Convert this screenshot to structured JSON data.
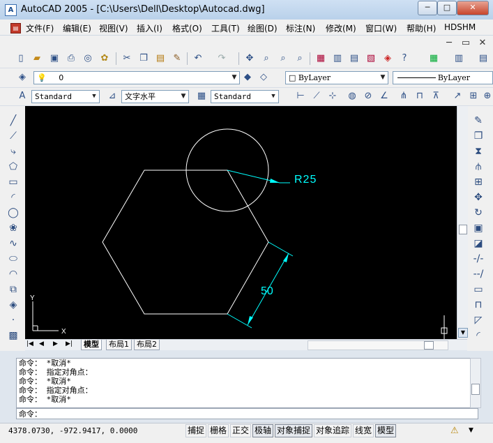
{
  "window": {
    "title": "AutoCAD 2005 - [C:\\Users\\Dell\\Desktop\\Autocad.dwg]",
    "app_icon_text": "A",
    "min_glyph": "─",
    "max_glyph": "□",
    "close_glyph": "✕"
  },
  "menu": {
    "items": [
      "文件(F)",
      "编辑(E)",
      "视图(V)",
      "插入(I)",
      "格式(O)",
      "工具(T)",
      "绘图(D)",
      "标注(N)",
      "修改(M)",
      "窗口(W)",
      "帮助(H)",
      "HDSHM"
    ],
    "doc_min": "─",
    "doc_restore": "▭",
    "doc_close": "✕"
  },
  "standard_toolbar": {
    "icons": [
      "new-icon",
      "open-icon",
      "save-icon",
      "print-icon",
      "preview-icon",
      "publish-icon",
      "cut-icon",
      "copy-icon",
      "paste-icon",
      "matchprop-icon",
      "undo-icon",
      "redo-icon",
      "pan-icon",
      "zoom-realtime-icon",
      "zoom-window-icon",
      "zoom-previous-icon",
      "properties-icon",
      "designcenter-icon",
      "toolpalettes-icon",
      "dbconnect-icon",
      "markup-icon",
      "help-icon"
    ]
  },
  "layers_toolbar": {
    "layer_value": "0",
    "color_value": "ByLayer",
    "linetype_value": "ByLayer"
  },
  "styles_toolbar": {
    "text_style": "Standard",
    "dim_style_text": "文字水平",
    "table_style": "Standard"
  },
  "drawing": {
    "radius_label": "R25",
    "dimension_label": "50",
    "ucs_y": "Y",
    "ucs_x": "X",
    "colors": {
      "background": "#000000",
      "geometry": "#ffffff",
      "dimension": "#00ffff"
    }
  },
  "layout_tabs": [
    "模型",
    "布局1",
    "布局2"
  ],
  "command": {
    "history": [
      "命令： *取消*",
      "命令： 指定对角点：",
      "命令： *取消*",
      "命令： 指定对角点：",
      "命令： *取消*"
    ],
    "prompt": "命令："
  },
  "status": {
    "coords": "4378.0730,  -972.9417,  0.0000",
    "toggles": [
      {
        "label": "捕捉",
        "on": false
      },
      {
        "label": "栅格",
        "on": false
      },
      {
        "label": "正交",
        "on": false
      },
      {
        "label": "极轴",
        "on": true
      },
      {
        "label": "对象捕捉",
        "on": true
      },
      {
        "label": "对象追踪",
        "on": false
      },
      {
        "label": "线宽",
        "on": false
      },
      {
        "label": "模型",
        "on": true
      }
    ]
  }
}
